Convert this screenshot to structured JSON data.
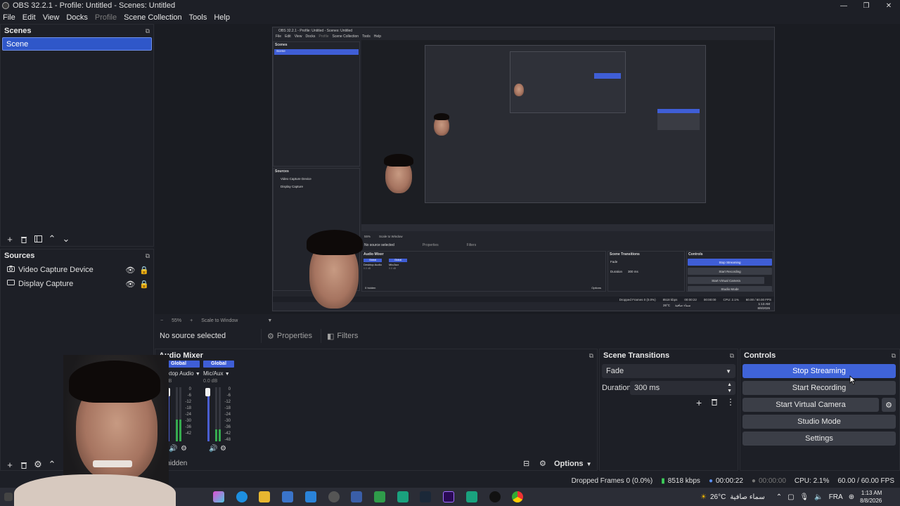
{
  "window": {
    "title": "OBS 32.2.1 - Profile: Untitled - Scenes: Untitled",
    "controls": {
      "minimize": "—",
      "restore": "❐",
      "close": "✕"
    }
  },
  "menu": [
    "File",
    "Edit",
    "View",
    "Docks",
    "Profile",
    "Scene Collection",
    "Tools",
    "Help"
  ],
  "scenes": {
    "title": "Scenes",
    "items": [
      "Scene"
    ]
  },
  "sources": {
    "title": "Sources",
    "items": [
      {
        "name": "Video Capture Device",
        "icon": "camera-icon"
      },
      {
        "name": "Display Capture",
        "icon": "monitor-icon"
      }
    ]
  },
  "preview_toolbar": {
    "zoom_out": "−",
    "zoom": "55%",
    "zoom_in": "+",
    "scale": "Scale to Window"
  },
  "context_bar": {
    "no_source": "No source selected",
    "properties": "Properties",
    "filters": "Filters"
  },
  "audio_mixer": {
    "title": "Audio Mixer",
    "channels": [
      {
        "tag": "Global",
        "name": "Desktop Audio",
        "db": "0.0 dB",
        "level": 0.4
      },
      {
        "tag": "Global",
        "name": "Mic/Aux",
        "db": "0.0 dB",
        "level": 0.22
      }
    ],
    "scale": [
      "0",
      "-6",
      "-12",
      "-18",
      "-24",
      "-30",
      "-36",
      "-42",
      "-48",
      "-54",
      "-60"
    ],
    "hidden": "0 hidden",
    "options": "Options"
  },
  "scene_transitions": {
    "title": "Scene Transitions",
    "transition": "Fade",
    "duration_label": "Duration",
    "duration_value": "300 ms"
  },
  "controls": {
    "title": "Controls",
    "stop_streaming": "Stop Streaming",
    "start_recording": "Start Recording",
    "start_virtual_camera": "Start Virtual Camera",
    "studio_mode": "Studio Mode",
    "settings": "Settings"
  },
  "status": {
    "dropped": "Dropped Frames 0 (0.0%)",
    "bitrate": "8518 kbps",
    "stream_time": "00:00:22",
    "rec_time": "00:00:00",
    "cpu": "CPU: 2.1%",
    "fps": "60.00 / 60.00 FPS"
  },
  "taskbar": {
    "weather": "26°C",
    "weather_text": "سماء صافية",
    "lang": "FRA",
    "time": "1:13 AM",
    "date": "8/8/2026"
  },
  "nested": {
    "title": "OBS 32.2.1 - Profile: Untitled - Scenes: Untitled",
    "menu": [
      "File",
      "Edit",
      "View",
      "Docks",
      "Profile",
      "Scene Collection",
      "Tools",
      "Help"
    ],
    "scenes_title": "Scenes",
    "scene_item": "Scene",
    "sources_title": "Sources",
    "source_items": [
      "Video Capture Device",
      "Display Capture"
    ],
    "no_source": "No source selected",
    "properties": "Properties",
    "filters": "Filters",
    "mixer_title": "Audio Mixer",
    "mixer_global": "Global",
    "mixer_ch1": "Desktop Audio",
    "mixer_ch2": "Mic/Aux",
    "mixer_db": "0.0 dB",
    "hidden": "0 hidden",
    "options": "Options",
    "trans_title": "Scene Transitions",
    "fade": "Fade",
    "duration": "Duration",
    "duration_value": "300 ms",
    "controls_title": "Controls",
    "stop_streaming": "Stop Streaming",
    "start_recording": "Start Recording",
    "start_virtual_camera": "Start Virtual Camera",
    "studio_mode": "Studio Mode",
    "settings": "Settings",
    "zoom": "55%",
    "scale": "Scale to Window",
    "status_dropped": "Dropped Frames 0 (0.0%)",
    "status_kbps": "8518 kbps",
    "status_time": "00:00:22",
    "status_rec": "00:00:00",
    "status_cpu": "CPU: 2.1%",
    "status_fps": "60.00 / 60.00 FPS",
    "weather": "26°C",
    "weather_text": "سماء صافية",
    "clock": "1:13 AM",
    "date": "8/8/2026"
  },
  "colors": {
    "accent": "#3f63d8",
    "bg": "#1d1f26",
    "button": "#3b3e47"
  }
}
